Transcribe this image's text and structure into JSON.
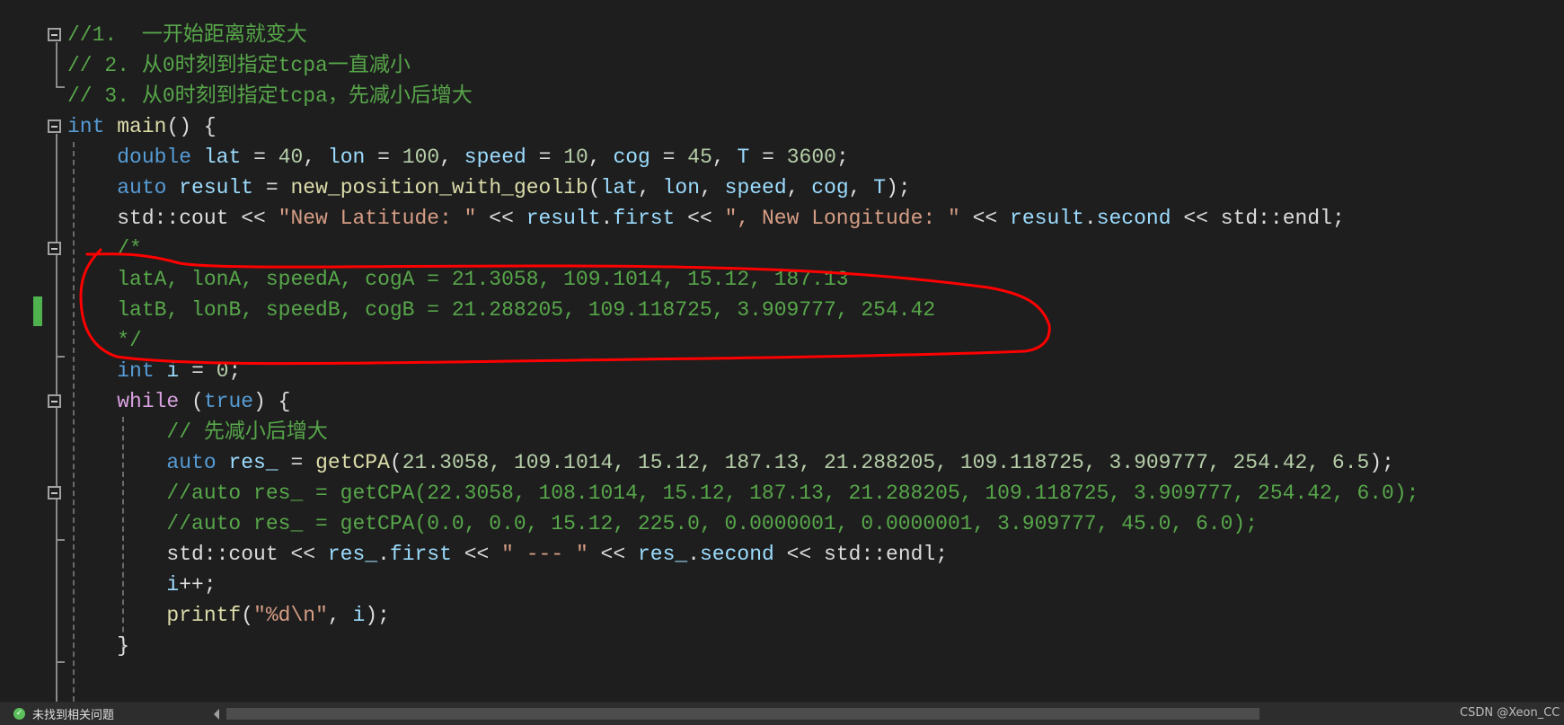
{
  "colors": {
    "background": "#1e1e1e",
    "comment": "#57a64a",
    "keyword": "#569cd6",
    "variable": "#9cdcfe",
    "function": "#dcdcaa",
    "number": "#b5cea8",
    "string": "#d69d85",
    "control": "#d8a0df",
    "annotation": "#ff0000",
    "change_marker": "#4fb24f"
  },
  "code": [
    [
      [
        "comment",
        "//1.  一开始距离就变大"
      ]
    ],
    [
      [
        "comment",
        "// 2. 从0时刻到指定tcpa一直减小"
      ]
    ],
    [
      [
        "comment",
        "// 3. 从0时刻到指定tcpa，先减小后增大"
      ]
    ],
    [
      [
        "kw",
        "int"
      ],
      [
        "plain",
        " "
      ],
      [
        "fn",
        "main"
      ],
      [
        "plain",
        "() {"
      ]
    ],
    [
      [
        "plain",
        "    "
      ],
      [
        "kw",
        "double"
      ],
      [
        "plain",
        " "
      ],
      [
        "var",
        "lat"
      ],
      [
        "plain",
        " = "
      ],
      [
        "num",
        "40"
      ],
      [
        "plain",
        ", "
      ],
      [
        "var",
        "lon"
      ],
      [
        "plain",
        " = "
      ],
      [
        "num",
        "100"
      ],
      [
        "plain",
        ", "
      ],
      [
        "var",
        "speed"
      ],
      [
        "plain",
        " = "
      ],
      [
        "num",
        "10"
      ],
      [
        "plain",
        ", "
      ],
      [
        "var",
        "cog"
      ],
      [
        "plain",
        " = "
      ],
      [
        "num",
        "45"
      ],
      [
        "plain",
        ", "
      ],
      [
        "var",
        "T"
      ],
      [
        "plain",
        " = "
      ],
      [
        "num",
        "3600"
      ],
      [
        "plain",
        ";"
      ]
    ],
    [
      [
        "plain",
        "    "
      ],
      [
        "kw",
        "auto"
      ],
      [
        "plain",
        " "
      ],
      [
        "var",
        "result"
      ],
      [
        "plain",
        " = "
      ],
      [
        "fn",
        "new_position_with_geolib"
      ],
      [
        "plain",
        "("
      ],
      [
        "var",
        "lat"
      ],
      [
        "plain",
        ", "
      ],
      [
        "var",
        "lon"
      ],
      [
        "plain",
        ", "
      ],
      [
        "var",
        "speed"
      ],
      [
        "plain",
        ", "
      ],
      [
        "var",
        "cog"
      ],
      [
        "plain",
        ", "
      ],
      [
        "var",
        "T"
      ],
      [
        "plain",
        ");"
      ]
    ],
    [
      [
        "plain",
        "    std::cout << "
      ],
      [
        "str",
        "\"New Latitude: \""
      ],
      [
        "plain",
        " << "
      ],
      [
        "var",
        "result"
      ],
      [
        "plain",
        "."
      ],
      [
        "var",
        "first"
      ],
      [
        "plain",
        " << "
      ],
      [
        "str",
        "\", New Longitude: \""
      ],
      [
        "plain",
        " << "
      ],
      [
        "var",
        "result"
      ],
      [
        "plain",
        "."
      ],
      [
        "var",
        "second"
      ],
      [
        "plain",
        " << std::endl;"
      ]
    ],
    [
      [
        "plain",
        "    "
      ],
      [
        "comment",
        "/*"
      ]
    ],
    [
      [
        "plain",
        "    "
      ],
      [
        "comment",
        "latA, lonA, speedA, cogA = 21.3058, 109.1014, 15.12, 187.13"
      ]
    ],
    [
      [
        "plain",
        "    "
      ],
      [
        "comment",
        "latB, lonB, speedB, cogB = 21.288205, 109.118725, 3.909777, 254.42"
      ]
    ],
    [
      [
        "plain",
        "    "
      ],
      [
        "comment",
        "*/"
      ]
    ],
    [
      [
        "plain",
        "    "
      ],
      [
        "kw",
        "int"
      ],
      [
        "plain",
        " "
      ],
      [
        "var",
        "i"
      ],
      [
        "plain",
        " = "
      ],
      [
        "num",
        "0"
      ],
      [
        "plain",
        ";"
      ]
    ],
    [
      [
        "plain",
        "    "
      ],
      [
        "ctrl",
        "while"
      ],
      [
        "plain",
        " ("
      ],
      [
        "kw",
        "true"
      ],
      [
        "plain",
        ") {"
      ]
    ],
    [
      [
        "plain",
        "        "
      ],
      [
        "comment",
        "// 先减小后增大"
      ]
    ],
    [
      [
        "plain",
        "        "
      ],
      [
        "kw",
        "auto"
      ],
      [
        "plain",
        " "
      ],
      [
        "var",
        "res_"
      ],
      [
        "plain",
        " = "
      ],
      [
        "fn",
        "getCPA"
      ],
      [
        "plain",
        "("
      ],
      [
        "num",
        "21.3058, 109.1014, 15.12, 187.13, 21.288205, 109.118725, 3.909777, 254.42, 6.5"
      ],
      [
        "plain",
        ");"
      ]
    ],
    [
      [
        "plain",
        "        "
      ],
      [
        "comment",
        "//auto res_ = getCPA(22.3058, 108.1014, 15.12, 187.13, 21.288205, 109.118725, 3.909777, 254.42, 6.0);"
      ]
    ],
    [
      [
        "plain",
        "        "
      ],
      [
        "comment",
        "//auto res_ = getCPA(0.0, 0.0, 15.12, 225.0, 0.0000001, 0.0000001, 3.909777, 45.0, 6.0);"
      ]
    ],
    [
      [
        "plain",
        "        std::cout << "
      ],
      [
        "var",
        "res_"
      ],
      [
        "plain",
        "."
      ],
      [
        "var",
        "first"
      ],
      [
        "plain",
        " << "
      ],
      [
        "str",
        "\" --- \""
      ],
      [
        "plain",
        " << "
      ],
      [
        "var",
        "res_"
      ],
      [
        "plain",
        "."
      ],
      [
        "var",
        "second"
      ],
      [
        "plain",
        " << std::endl;"
      ]
    ],
    [
      [
        "plain",
        "        "
      ],
      [
        "var",
        "i"
      ],
      [
        "plain",
        "++;"
      ]
    ],
    [
      [
        "plain",
        "        "
      ],
      [
        "fn",
        "printf"
      ],
      [
        "plain",
        "("
      ],
      [
        "str",
        "\"%d\\n\""
      ],
      [
        "plain",
        ", "
      ],
      [
        "var",
        "i"
      ],
      [
        "plain",
        ");"
      ]
    ],
    [
      [
        "plain",
        "    }"
      ]
    ]
  ],
  "status": {
    "issues_icon": "check-circle-icon",
    "issues_text": "未找到相关问题",
    "watermark": "CSDN @Xeon_CC"
  }
}
